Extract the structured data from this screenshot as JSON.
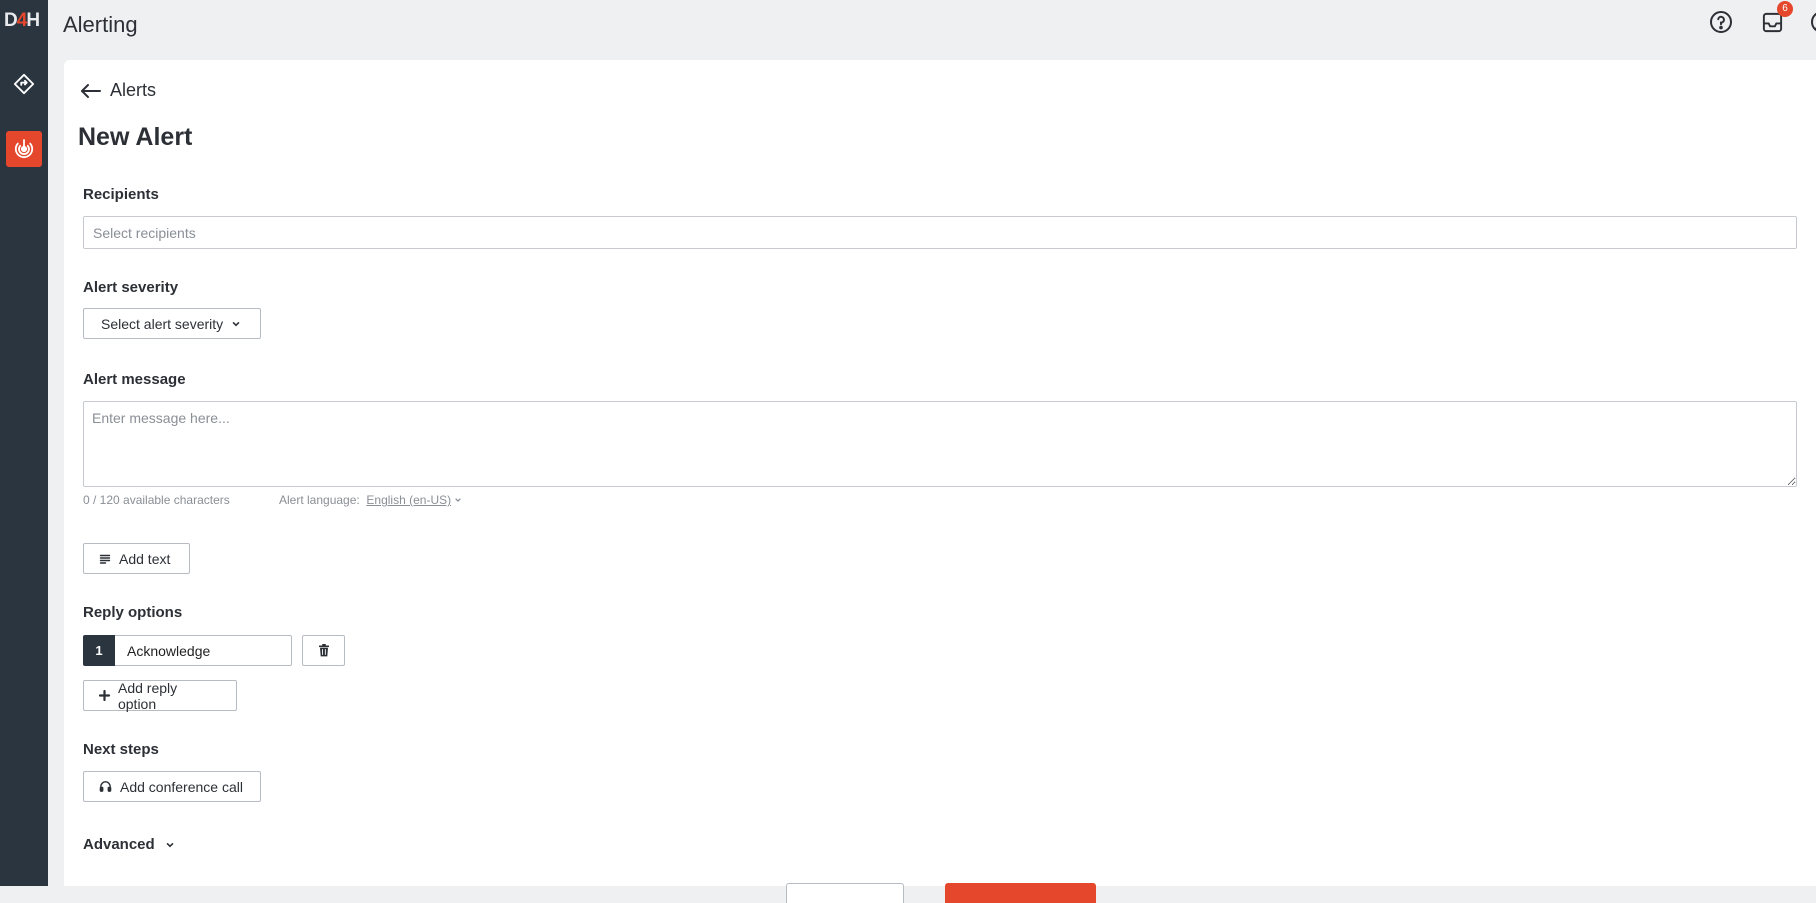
{
  "app": {
    "logo": {
      "left": "D",
      "mid": "4",
      "right": "H"
    },
    "title": "Alerting"
  },
  "sidebar": {
    "items": [
      {
        "icon": "diamond-arrow-icon",
        "active": false
      },
      {
        "icon": "alerting-icon",
        "active": true
      }
    ]
  },
  "header": {
    "icons": [
      "help-icon",
      "inbox-icon",
      "user-icon"
    ],
    "inbox_badge": "6"
  },
  "breadcrumb": {
    "back_label": "Alerts"
  },
  "page": {
    "title": "New Alert"
  },
  "form": {
    "recipients": {
      "label": "Recipients",
      "placeholder": "Select recipients"
    },
    "severity": {
      "label": "Alert severity",
      "select_label": "Select alert severity"
    },
    "message": {
      "label": "Alert message",
      "placeholder": "Enter message here...",
      "char_count": "0 / 120 available characters",
      "language_label": "Alert language:",
      "language_value": "English (en-US)"
    },
    "add_text_label": "Add text",
    "reply_options": {
      "label": "Reply options",
      "items": [
        {
          "number": "1",
          "value": "Acknowledge"
        }
      ],
      "add_label": "Add reply option"
    },
    "next_steps": {
      "label": "Next steps",
      "add_call_label": "Add conference call"
    },
    "advanced_label": "Advanced"
  },
  "colors": {
    "accent": "#e4472c",
    "sidebar": "#2b3540",
    "background": "#eef0f2"
  }
}
